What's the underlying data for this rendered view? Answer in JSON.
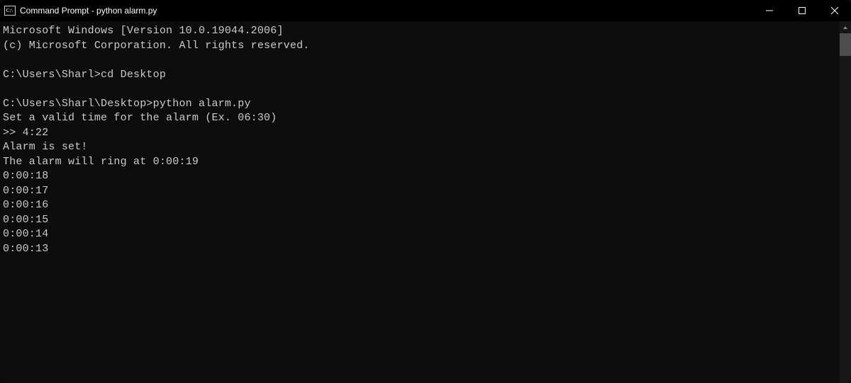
{
  "titlebar": {
    "title": "Command Prompt - python  alarm.py"
  },
  "terminal": {
    "lines": [
      "Microsoft Windows [Version 10.0.19044.2006]",
      "(c) Microsoft Corporation. All rights reserved.",
      "",
      "C:\\Users\\Sharl>cd Desktop",
      "",
      "C:\\Users\\Sharl\\Desktop>python alarm.py",
      "Set a valid time for the alarm (Ex. 06:30)",
      ">> 4:22",
      "Alarm is set!",
      "The alarm will ring at 0:00:19",
      "0:00:18",
      "0:00:17",
      "0:00:16",
      "0:00:15",
      "0:00:14",
      "0:00:13"
    ]
  }
}
